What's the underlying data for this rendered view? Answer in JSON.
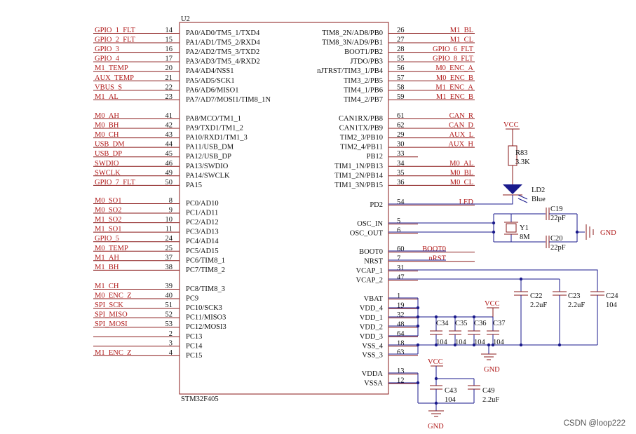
{
  "chip": {
    "ref": "U2",
    "part": "STM32F405"
  },
  "left_pins": [
    {
      "net": "GPIO_1_FLT",
      "num": "14",
      "name": "PA0/AD0/TM5_1/TXD4"
    },
    {
      "net": "GPIO_2_FLT",
      "num": "15",
      "name": "PA1/AD1/TM5_2/RXD4"
    },
    {
      "net": "GPIO_3",
      "num": "16",
      "name": "PA2/AD2/TM5_3/TXD2"
    },
    {
      "net": "GPIO_4",
      "num": "17",
      "name": "PA3/AD3/TM5_4/RXD2"
    },
    {
      "net": "M1_TEMP",
      "num": "20",
      "name": "PA4/AD4/NSS1"
    },
    {
      "net": "AUX_TEMP",
      "num": "21",
      "name": "PA5/AD5/SCK1"
    },
    {
      "net": "VBUS_S",
      "num": "22",
      "name": "PA6/AD6/MISO1"
    },
    {
      "net": "M1_AL",
      "num": "23",
      "name": "PA7/AD7/MOSI1/TIM8_1N"
    },
    {
      "net": "M0_AH",
      "num": "41",
      "name": "PA8/MCO/TM1_1"
    },
    {
      "net": "M0_BH",
      "num": "42",
      "name": "PA9/TXD1/TM1_2"
    },
    {
      "net": "M0_CH",
      "num": "43",
      "name": "PA10/RXD1/TM1_3"
    },
    {
      "net": "USB_DM",
      "num": "44",
      "name": "PA11/USB_DM"
    },
    {
      "net": "USB_DP",
      "num": "45",
      "name": "PA12/USB_DP"
    },
    {
      "net": "SWDIO",
      "num": "46",
      "name": "PA13/SWDIO"
    },
    {
      "net": "SWCLK",
      "num": "49",
      "name": "PA14/SWCLK"
    },
    {
      "net": "GPIO_7_FLT",
      "num": "50",
      "name": "PA15"
    },
    {
      "net": "M0_SO1",
      "num": "8",
      "name": "PC0/AD10"
    },
    {
      "net": "M0_SO2",
      "num": "9",
      "name": "PC1/AD11"
    },
    {
      "net": "M1_SO2",
      "num": "10",
      "name": "PC2/AD12"
    },
    {
      "net": "M1_SO1",
      "num": "11",
      "name": "PC3/AD13"
    },
    {
      "net": "GPIO_5",
      "num": "24",
      "name": "PC4/AD14"
    },
    {
      "net": "M0_TEMP",
      "num": "25",
      "name": "PC5/AD15"
    },
    {
      "net": "M1_AH",
      "num": "37",
      "name": "PC6/TIM8_1"
    },
    {
      "net": "M1_BH",
      "num": "38",
      "name": "PC7/TIM8_2"
    },
    {
      "net": "M1_CH",
      "num": "39",
      "name": "PC8/TIM8_3"
    },
    {
      "net": "M0_ENC_Z",
      "num": "40",
      "name": "PC9"
    },
    {
      "net": "SPI_SCK",
      "num": "51",
      "name": "PC10/SCK3"
    },
    {
      "net": "SPI_MISO",
      "num": "52",
      "name": "PC11/MISO3"
    },
    {
      "net": "SPI_MOSI",
      "num": "53",
      "name": "PC12/MOSI3"
    },
    {
      "net": "",
      "num": "2",
      "name": "PC13"
    },
    {
      "net": "",
      "num": "3",
      "name": "PC14"
    },
    {
      "net": "M1_ENC_Z",
      "num": "4",
      "name": "PC15"
    }
  ],
  "right_pins": [
    {
      "name": "TIM8_2N/AD8/PB0",
      "num": "26",
      "net": "M1_BL"
    },
    {
      "name": "TIM8_3N/AD9/PB1",
      "num": "27",
      "net": "M1_CL"
    },
    {
      "name": "BOOT1/PB2",
      "num": "28",
      "net": "GPIO_6_FLT"
    },
    {
      "name": "JTDO/PB3",
      "num": "55",
      "net": "GPIO_8_FLT"
    },
    {
      "name": "nJTRST/TIM3_1/PB4",
      "num": "56",
      "net": "M0_ENC_A"
    },
    {
      "name": "TIM3_2/PB5",
      "num": "57",
      "net": "M0_ENC_B"
    },
    {
      "name": "TIM4_1/PB6",
      "num": "58",
      "net": "M1_ENC_A"
    },
    {
      "name": "TIM4_2/PB7",
      "num": "59",
      "net": "M1_ENC_B"
    },
    {
      "name": "CAN1RX/PB8",
      "num": "61",
      "net": "CAN_R"
    },
    {
      "name": "CAN1TX/PB9",
      "num": "62",
      "net": "CAN_D"
    },
    {
      "name": "TIM2_3/PB10",
      "num": "29",
      "net": "AUX_L"
    },
    {
      "name": "TIM2_4/PB11",
      "num": "30",
      "net": "AUX_H"
    },
    {
      "name": "PB12",
      "num": "33",
      "net": ""
    },
    {
      "name": "TIM1_1N/PB13",
      "num": "34",
      "net": "M0_AL"
    },
    {
      "name": "TIM1_2N/PB14",
      "num": "35",
      "net": "M0_BL"
    },
    {
      "name": "TIM1_3N/PB15",
      "num": "36",
      "net": "M0_CL"
    },
    {
      "name": "PD2",
      "num": "54",
      "net": "LED"
    },
    {
      "name": "OSC_IN",
      "num": "5",
      "net": ""
    },
    {
      "name": "OSC_OUT",
      "num": "6",
      "net": ""
    },
    {
      "name": "BOOT0",
      "num": "60",
      "net": "BOOT0"
    },
    {
      "name": "NRST",
      "num": "7",
      "net": "nRST"
    },
    {
      "name": "VCAP_1",
      "num": "31",
      "net": ""
    },
    {
      "name": "VCAP_2",
      "num": "47",
      "net": ""
    },
    {
      "name": "VBAT",
      "num": "1",
      "net": ""
    },
    {
      "name": "VDD_4",
      "num": "19",
      "net": ""
    },
    {
      "name": "VDD_1",
      "num": "32",
      "net": ""
    },
    {
      "name": "VDD_2",
      "num": "48",
      "net": ""
    },
    {
      "name": "VDD_3",
      "num": "64",
      "net": ""
    },
    {
      "name": "VSS_4",
      "num": "18",
      "net": ""
    },
    {
      "name": "VSS_3",
      "num": "63",
      "net": ""
    },
    {
      "name": "VDDA",
      "num": "13",
      "net": ""
    },
    {
      "name": "VSSA",
      "num": "12",
      "net": ""
    }
  ],
  "components": {
    "r83": {
      "ref": "R83",
      "value": "3.3K"
    },
    "ld2": {
      "ref": "LD2",
      "value": "Blue"
    },
    "y1": {
      "ref": "Y1",
      "value": "8M"
    },
    "c19": {
      "ref": "C19",
      "value": "22pF"
    },
    "c20": {
      "ref": "C20",
      "value": "22pF"
    },
    "c22": {
      "ref": "C22",
      "value": "2.2uF"
    },
    "c23": {
      "ref": "C23",
      "value": "2.2uF"
    },
    "c24": {
      "ref": "C24",
      "value": "104"
    },
    "c34": {
      "ref": "C34",
      "value": "104"
    },
    "c35": {
      "ref": "C35",
      "value": "104"
    },
    "c36": {
      "ref": "C36",
      "value": "104"
    },
    "c37": {
      "ref": "C37",
      "value": "104"
    },
    "c43": {
      "ref": "C43",
      "value": "104"
    },
    "c49": {
      "ref": "C49",
      "value": "2.2uF"
    }
  },
  "power": {
    "vcc": "VCC",
    "gnd": "GND"
  },
  "watermark": "CSDN @loop222"
}
